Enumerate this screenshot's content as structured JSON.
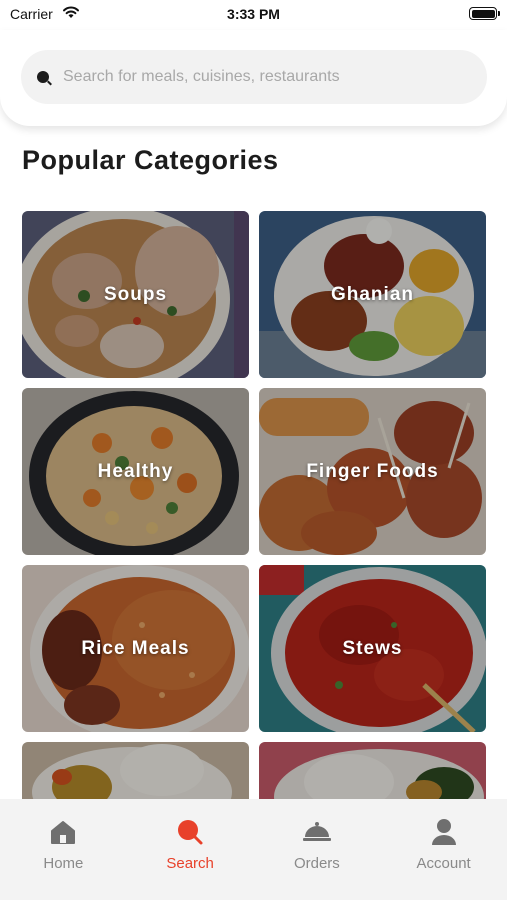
{
  "status_bar": {
    "carrier": "Carrier",
    "time": "3:33 PM"
  },
  "search": {
    "placeholder": "Search for meals, cuisines, restaurants"
  },
  "section_title": "Popular Categories",
  "categories": [
    {
      "label": "Soups"
    },
    {
      "label": "Ghanian"
    },
    {
      "label": "Healthy"
    },
    {
      "label": "Finger Foods"
    },
    {
      "label": "Rice Meals"
    },
    {
      "label": "Stews"
    }
  ],
  "tabs": [
    {
      "label": "Home",
      "icon": "home-icon"
    },
    {
      "label": "Search",
      "icon": "search-icon"
    },
    {
      "label": "Orders",
      "icon": "cloche-icon"
    },
    {
      "label": "Account",
      "icon": "user-icon"
    }
  ],
  "colors": {
    "accent": "#e8412a",
    "inactive": "#8a8a8a",
    "tab_bar": "#f3f3f3"
  }
}
